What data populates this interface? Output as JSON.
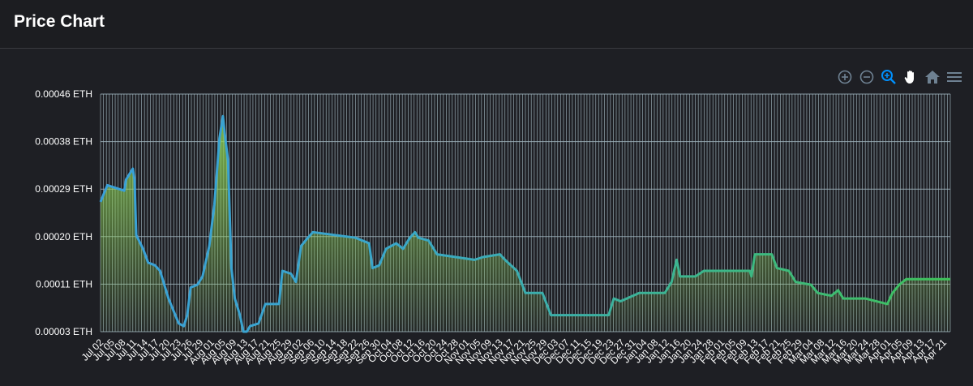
{
  "header": {
    "title": "Price Chart"
  },
  "toolbar": {
    "icons": [
      "zoom-in-icon",
      "zoom-out-icon",
      "selection-zoom-icon",
      "pan-icon",
      "home-icon",
      "menu-icon"
    ],
    "active_color": "#008ffb",
    "inactive_color": "#6e8192"
  },
  "colors": {
    "line_start": "#3aa0d8",
    "line_end": "#3fc25a",
    "fill": "#7ec850",
    "grid": "#9fb4bd"
  },
  "chart_data": {
    "type": "area",
    "title": "",
    "xlabel": "",
    "ylabel": "",
    "y_unit": "ETH",
    "y_ticks": [
      "0.00003 ETH",
      "0.00011 ETH",
      "0.00020 ETH",
      "0.00029 ETH",
      "0.00038 ETH",
      "0.00046 ETH"
    ],
    "ylim": [
      3e-05,
      0.00046
    ],
    "x_ticks": [
      "Jul 02",
      "Jul 05",
      "Jul 08",
      "Jul 11",
      "Jul 14",
      "Jul 17",
      "Jul 20",
      "Jul 23",
      "Jul 26",
      "Jul 29",
      "Aug 01",
      "Aug 05",
      "Aug 09",
      "Aug 13",
      "Aug 17",
      "Aug 21",
      "Aug 25",
      "Aug 29",
      "Sep 02",
      "Sep 06",
      "Sep 10",
      "Sep 14",
      "Sep 18",
      "Sep 22",
      "Sep 26",
      "Sep 30",
      "Oct 04",
      "Oct 08",
      "Oct 12",
      "Oct 16",
      "Oct 20",
      "Oct 24",
      "Oct 28",
      "Nov 01",
      "Nov 05",
      "Nov 09",
      "Nov 13",
      "Nov 17",
      "Nov 21",
      "Nov 25",
      "Nov 29",
      "Dec 03",
      "Dec 07",
      "Dec 11",
      "Dec 15",
      "Dec 19",
      "Dec 23",
      "Dec 27",
      "Dec 31",
      "Jan 04",
      "Jan 08",
      "Jan 12",
      "Jan 16",
      "Jan 20",
      "Jan 24",
      "Jan 28",
      "Feb 01",
      "Feb 05",
      "Feb 09",
      "Feb 13",
      "Feb 17",
      "Feb 21",
      "Feb 25",
      "Feb 29",
      "Mar 04",
      "Mar 08",
      "Mar 12",
      "Mar 16",
      "Mar 20",
      "Mar 24",
      "Mar 28",
      "Apr 01",
      "Apr 05",
      "Apr 09",
      "Apr 13",
      "Apr 17",
      "Apr 21"
    ],
    "series": [
      {
        "values": [
          [
            0.0,
            0.000265
          ],
          [
            0.008,
            0.000295
          ],
          [
            0.028,
            0.000285
          ],
          [
            0.03,
            0.000305
          ],
          [
            0.038,
            0.000325
          ],
          [
            0.04,
            0.000305
          ],
          [
            0.042,
            0.000205
          ],
          [
            0.05,
            0.00018
          ],
          [
            0.056,
            0.000155
          ],
          [
            0.064,
            0.00015
          ],
          [
            0.07,
            0.00014
          ],
          [
            0.08,
            9e-05
          ],
          [
            0.088,
            6e-05
          ],
          [
            0.092,
            4.5e-05
          ],
          [
            0.098,
            4e-05
          ],
          [
            0.102,
            6e-05
          ],
          [
            0.106,
            0.00011
          ],
          [
            0.114,
            0.000115
          ],
          [
            0.12,
            0.00013
          ],
          [
            0.128,
            0.000185
          ],
          [
            0.134,
            0.00026
          ],
          [
            0.14,
            0.00038
          ],
          [
            0.144,
            0.00042
          ],
          [
            0.146,
            0.00039
          ],
          [
            0.15,
            0.00034
          ],
          [
            0.154,
            0.000145
          ],
          [
            0.158,
            9e-05
          ],
          [
            0.164,
            6e-05
          ],
          [
            0.168,
            3e-05
          ],
          [
            0.172,
            3e-05
          ],
          [
            0.176,
            4e-05
          ],
          [
            0.186,
            4.5e-05
          ],
          [
            0.194,
            8e-05
          ],
          [
            0.21,
            8e-05
          ],
          [
            0.214,
            0.00014
          ],
          [
            0.224,
            0.000135
          ],
          [
            0.23,
            0.00012
          ],
          [
            0.236,
            0.000185
          ],
          [
            0.244,
            0.0002
          ],
          [
            0.25,
            0.00021
          ],
          [
            0.3,
            0.0002
          ],
          [
            0.316,
            0.00019
          ],
          [
            0.32,
            0.000145
          ],
          [
            0.328,
            0.00015
          ],
          [
            0.336,
            0.00018
          ],
          [
            0.348,
            0.00019
          ],
          [
            0.356,
            0.00018
          ],
          [
            0.364,
            0.0002
          ],
          [
            0.37,
            0.00021
          ],
          [
            0.374,
            0.0002
          ],
          [
            0.386,
            0.000195
          ],
          [
            0.396,
            0.00017
          ],
          [
            0.44,
            0.00016
          ],
          [
            0.45,
            0.000165
          ],
          [
            0.47,
            0.00017
          ],
          [
            0.476,
            0.00016
          ],
          [
            0.49,
            0.00014
          ],
          [
            0.5,
            0.0001
          ],
          [
            0.52,
            0.0001
          ],
          [
            0.53,
            6e-05
          ],
          [
            0.598,
            6e-05
          ],
          [
            0.604,
            9e-05
          ],
          [
            0.612,
            8.5e-05
          ],
          [
            0.634,
            0.0001
          ],
          [
            0.664,
            0.0001
          ],
          [
            0.672,
            0.00012
          ],
          [
            0.678,
            0.00016
          ],
          [
            0.682,
            0.00013
          ],
          [
            0.7,
            0.00013
          ],
          [
            0.71,
            0.00014
          ],
          [
            0.764,
            0.00014
          ],
          [
            0.766,
            0.00013
          ],
          [
            0.77,
            0.00017
          ],
          [
            0.79,
            0.00017
          ],
          [
            0.796,
            0.000145
          ],
          [
            0.81,
            0.00014
          ],
          [
            0.818,
            0.00012
          ],
          [
            0.836,
            0.000115
          ],
          [
            0.844,
            0.0001
          ],
          [
            0.86,
            9.5e-05
          ],
          [
            0.868,
            0.000105
          ],
          [
            0.874,
            9e-05
          ],
          [
            0.9,
            9e-05
          ],
          [
            0.926,
            8e-05
          ],
          [
            0.932,
            0.0001
          ],
          [
            0.94,
            0.000115
          ],
          [
            0.948,
            0.000125
          ],
          [
            1.0,
            0.000125
          ]
        ]
      }
    ],
    "grid": true
  }
}
